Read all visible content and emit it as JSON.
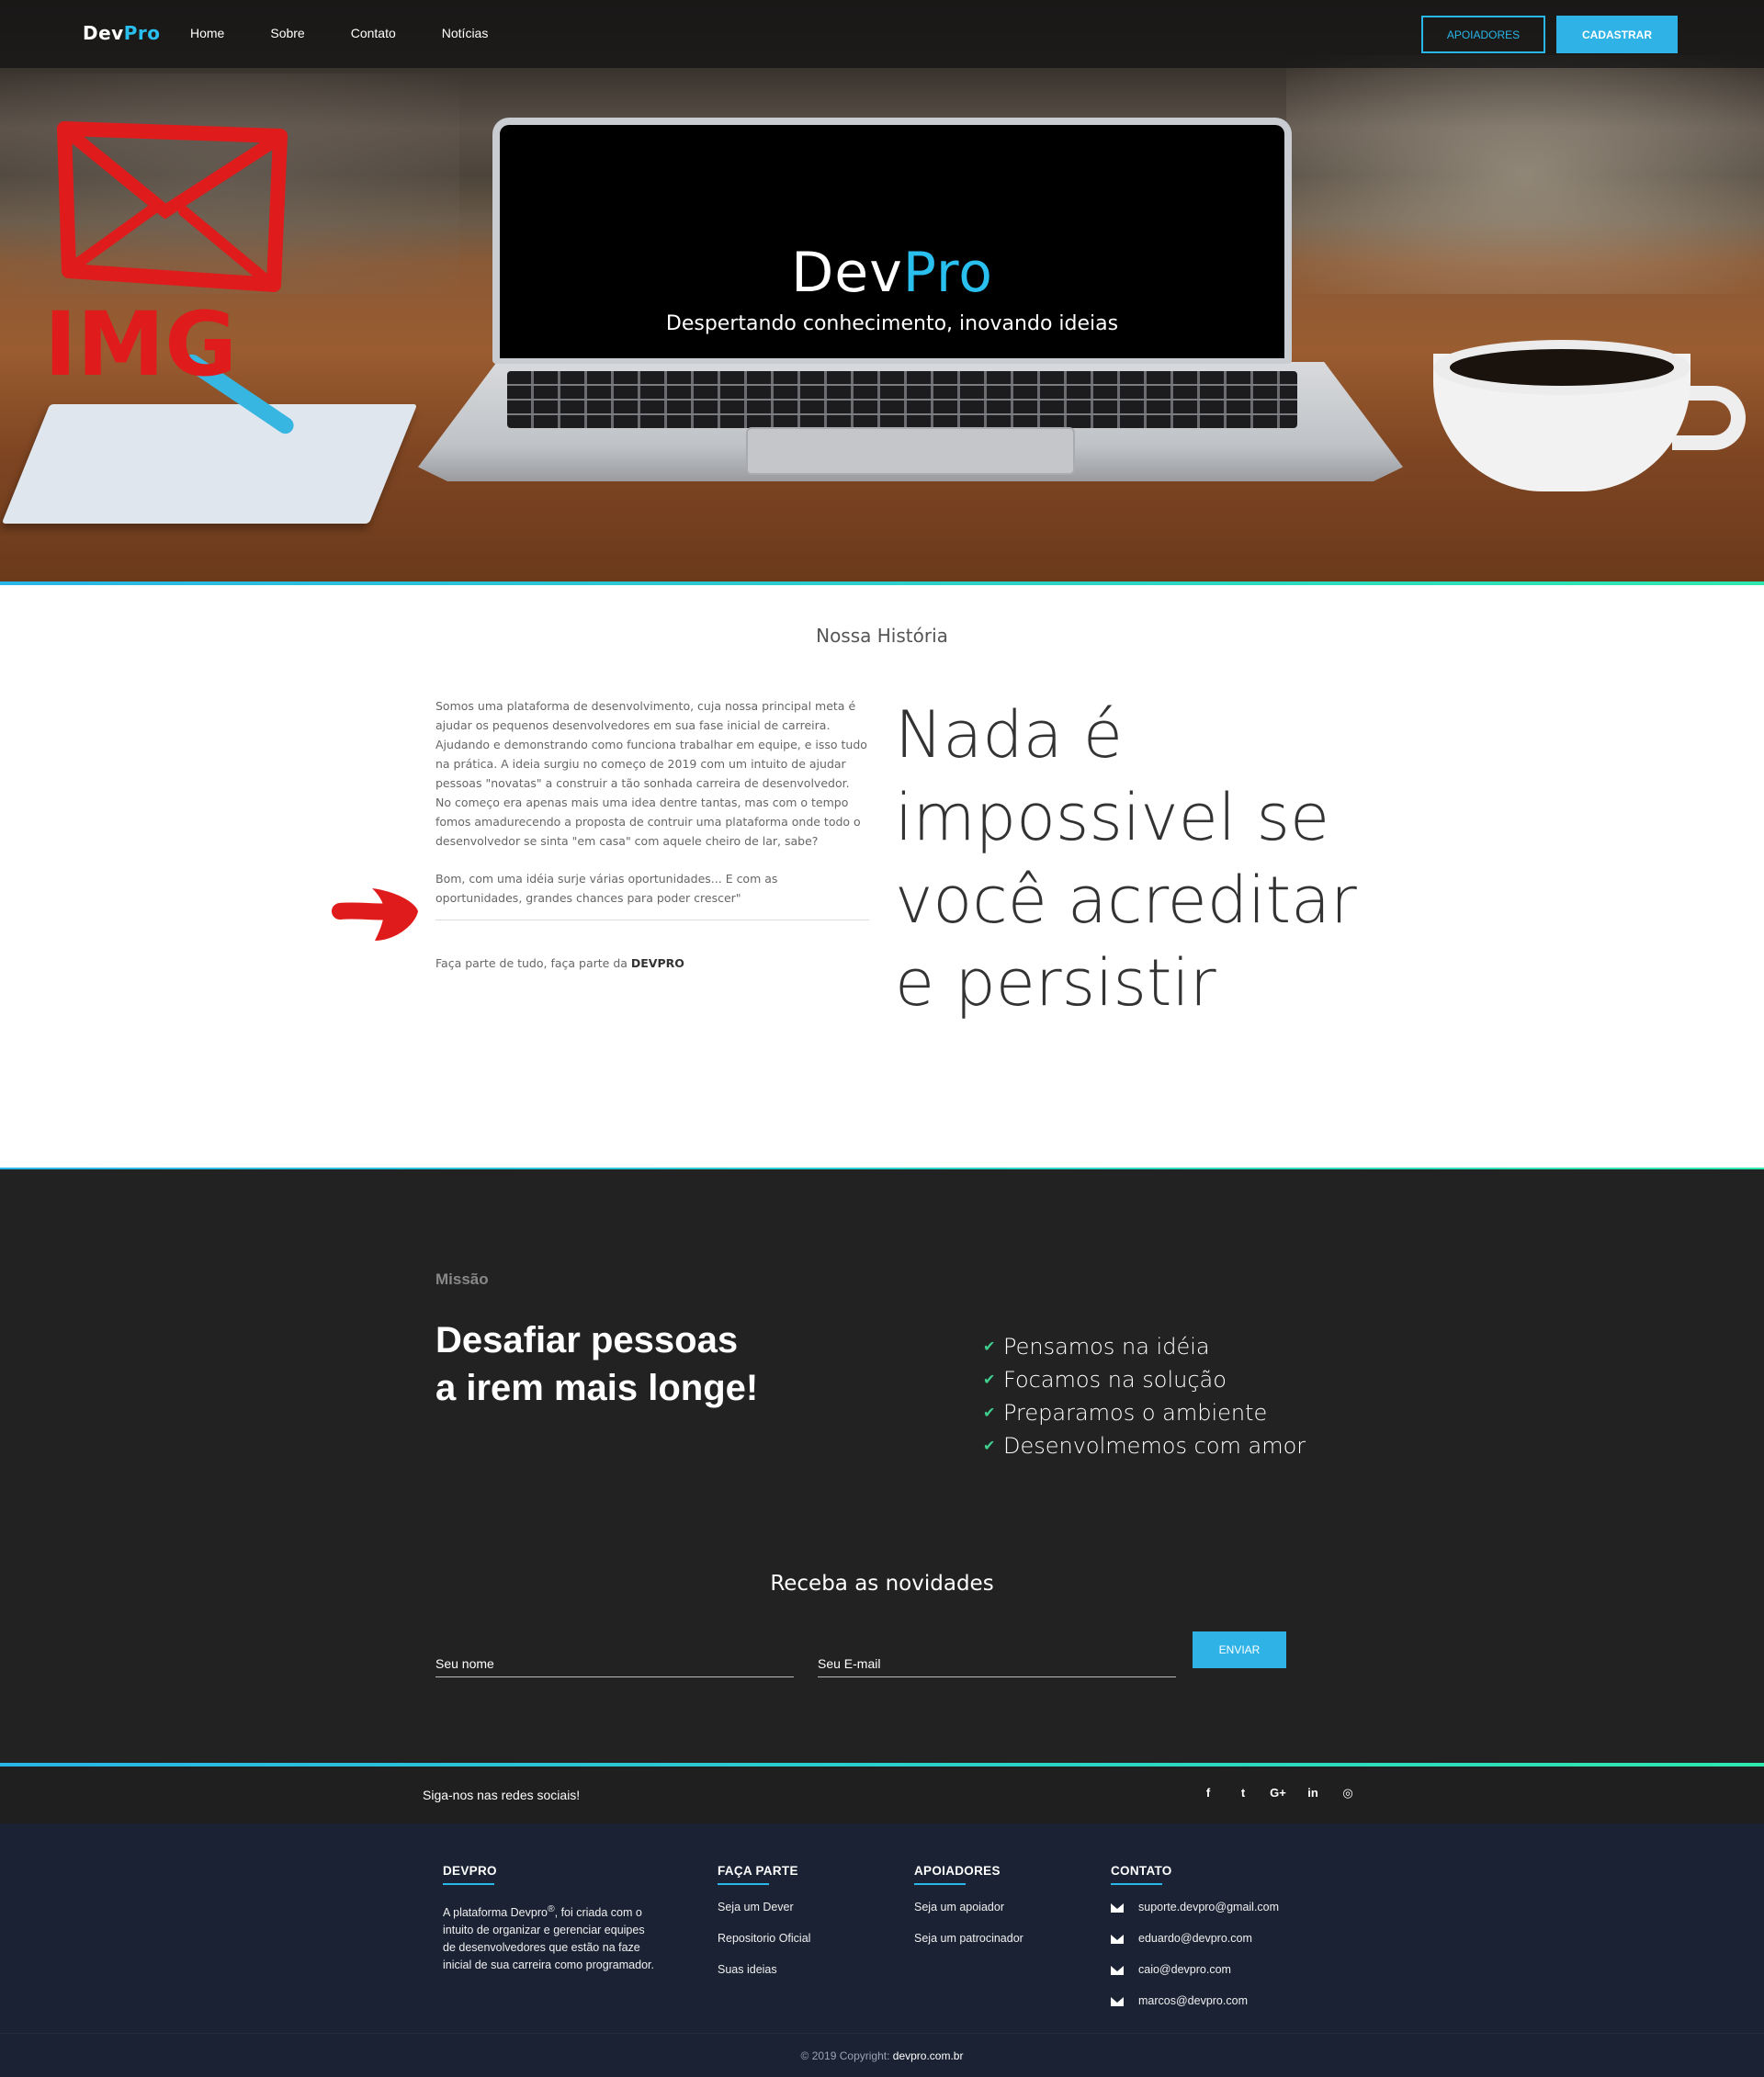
{
  "nav": {
    "logo_a": "Dev",
    "logo_b": "Pro",
    "links": [
      "Home",
      "Sobre",
      "Contato",
      "Notícias"
    ],
    "btn_supporters": "APOIADORES",
    "btn_signup": "CADASTRAR"
  },
  "hero": {
    "title_a": "Dev",
    "title_b": "Pro",
    "subtitle": "Despertando conhecimento, inovando ideias",
    "scribble_text": "IMG"
  },
  "history": {
    "title": "Nossa História",
    "p1": "Somos uma plataforma de desenvolvimento, cuja nossa principal meta é ajudar os pequenos desenvolvedores em sua fase inicial de carreira. Ajudando e demonstrando como funciona trabalhar em equipe, e isso tudo na prática. A ideia surgiu no começo de 2019 com um intuito de ajudar pessoas \"novatas\" a construir a tão sonhada carreira de desenvolvedor. No começo era apenas mais uma idea dentre tantas, mas com o tempo fomos amadurecendo a proposta de contruir uma plataforma onde todo o desenvolvedor se sinta \"em casa\" com aquele cheiro de lar, sabe?",
    "p2": "Bom, com uma idéia surje várias oportunidades... E com as oportunidades, grandes chances para poder crescer\"",
    "p3_text": "Faça parte de tudo, faça parte da ",
    "p3_bold": "DEVPRO",
    "quote": "Nada é impossivel se você acreditar e persistir"
  },
  "mission": {
    "label": "Missão",
    "title": "Desafiar pessoas a irem mais longe!",
    "items": [
      "Pensamos na idéia",
      "Focamos na solução",
      "Preparamos o ambiente",
      "Desenvolmemos com amor"
    ]
  },
  "newsletter": {
    "title": "Receba as novidades",
    "name_placeholder": "Seu nome",
    "email_placeholder": "Seu E-mail",
    "send": "ENVIAR"
  },
  "social": {
    "text": "Siga-nos nas redes sociais!",
    "icons": [
      "facebook-icon",
      "twitter-icon",
      "google-plus-icon",
      "linkedin-icon",
      "instagram-icon"
    ],
    "glyphs": [
      "f",
      "t",
      "G+",
      "in",
      "◎"
    ]
  },
  "footer": {
    "col1_title": "DEVPRO",
    "col1_text_a": "A plataforma Devpro",
    "col1_text_sup": "®",
    "col1_text_b": ", foi criada com o intuito de organizar e gerenciar equipes de desenvolvedores que estão na faze inicial de sua carreira como programador.",
    "col2_title": "FAÇA PARTE",
    "col2_links": [
      "Seja um Dever",
      "Repositorio Oficial",
      "Suas ideias"
    ],
    "col3_title": "APOIADORES",
    "col3_links": [
      "Seja um apoiador",
      "Seja um patrocinador"
    ],
    "col4_title": "CONTATO",
    "col4_emails": [
      "suporte.devpro@gmail.com",
      "eduardo@devpro.com",
      "caio@devpro.com",
      "marcos@devpro.com"
    ],
    "copyright_text": "© 2019 Copyright: ",
    "copyright_site": "devpro.com.br"
  },
  "colors": {
    "accent": "#29b6e8",
    "accent_green": "#2ee8b0",
    "dark_bg": "#222222",
    "footer_bg": "#1a2233",
    "scribble_red": "#e01b1b"
  }
}
